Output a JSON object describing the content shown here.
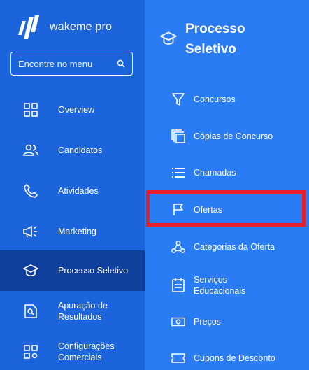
{
  "brand": {
    "name": "wakeme pro"
  },
  "search": {
    "placeholder": "Encontre no menu"
  },
  "nav": [
    {
      "label": "Overview",
      "icon": "grid-icon"
    },
    {
      "label": "Candidatos",
      "icon": "users-icon"
    },
    {
      "label": "Atividades",
      "icon": "phone-icon"
    },
    {
      "label": "Marketing",
      "icon": "megaphone-icon"
    },
    {
      "label": "Processo Seletivo",
      "icon": "graduation-cap-icon",
      "active": true
    },
    {
      "label": "Apuração de Resultados",
      "icon": "document-search-icon"
    },
    {
      "label": "Configurações Comerciais",
      "icon": "grid-settings-icon"
    }
  ],
  "submenu": {
    "title": "Processo Seletivo",
    "items": [
      {
        "label": "Concursos",
        "icon": "filter-icon"
      },
      {
        "label": "Cópias de Concurso",
        "icon": "copy-icon"
      },
      {
        "label": "Chamadas",
        "icon": "list-icon"
      },
      {
        "label": "Ofertas",
        "icon": "flag-icon",
        "highlighted": true
      },
      {
        "label": "Categorias da Oferta",
        "icon": "hierarchy-icon"
      },
      {
        "label": "Serviços Educacionais",
        "icon": "service-list-icon"
      },
      {
        "label": "Preços",
        "icon": "money-icon"
      },
      {
        "label": "Cupons de Desconto",
        "icon": "coupon-icon"
      }
    ]
  },
  "colors": {
    "sidebar": "#1b64db",
    "active": "#0e3f9c",
    "submenu": "#2a7cf4",
    "highlight": "#e8202e"
  }
}
